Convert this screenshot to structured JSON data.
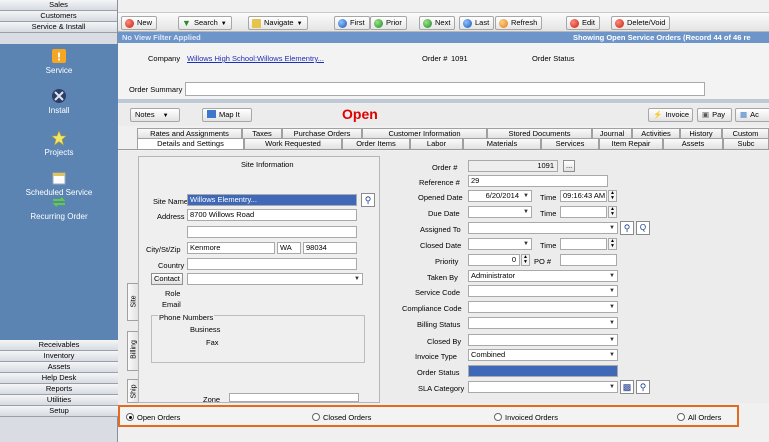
{
  "leftnav": {
    "top_items": [
      "Sales",
      "Customers",
      "Service & Install"
    ],
    "modules": [
      {
        "label": "Service",
        "icon": "warning-icon"
      },
      {
        "label": "Install",
        "icon": "tools-icon"
      },
      {
        "label": "Projects",
        "icon": "star-icon"
      },
      {
        "label": "Scheduled Service",
        "icon": "calendar-icon"
      },
      {
        "label": "Recurring Order",
        "icon": "recycle-icon"
      }
    ],
    "bottom_items": [
      "Receivables",
      "Inventory",
      "Assets",
      "Help Desk",
      "Reports",
      "Utilities",
      "Setup"
    ]
  },
  "toolbar": {
    "new": "New",
    "search": "Search",
    "navigate": "Navigate",
    "first": "First",
    "prior": "Prior",
    "next": "Next",
    "last": "Last",
    "refresh": "Refresh",
    "edit": "Edit",
    "delete_void": "Delete/Void"
  },
  "bluebar": {
    "filter": "No View Filter Applied",
    "status": "Showing Open Service Orders   (Record 44 of 46 re"
  },
  "header": {
    "company_label": "Company",
    "company_value": "Willows High School:Willows Elementry...",
    "order_label": "Order #",
    "order_value": "1091",
    "order_status_label": "Order Status",
    "order_summary_label": "Order Summary",
    "order_summary_value": ""
  },
  "actionbar": {
    "notes": "Notes",
    "map_it": "Map It",
    "status": "Open",
    "invoice": "Invoice",
    "pay": "Pay",
    "ac": "Ac"
  },
  "tabs_row1": [
    "Rates and Assignments",
    "Taxes",
    "Purchase Orders",
    "Customer Information",
    "Stored Documents",
    "Journal",
    "Activities",
    "History",
    "Custom"
  ],
  "tabs_row2": [
    "Details and Settings",
    "Work Requested",
    "Order Items",
    "Labor",
    "Materials",
    "Services",
    "Item Repair",
    "Assets",
    "Subc"
  ],
  "site": {
    "section_title": "Site Information",
    "site_name_label": "Site Name",
    "site_name_value": "Willows Elementry...",
    "address_label": "Address",
    "address_value": "8700 Willows Road",
    "address2_value": "",
    "city_label": "City/St/Zip",
    "city_value": "Kenmore",
    "state_value": "WA",
    "zip_value": "98034",
    "country_label": "Country",
    "country_value": "",
    "contact_label": "Contact",
    "contact_value": "",
    "role_label": "Role",
    "email_label": "Email",
    "phone_numbers_label": "Phone Numbers",
    "business_label": "Business",
    "fax_label": "Fax",
    "zone_label": "Zone",
    "vtabs": [
      "Site",
      "Billing",
      "Ship"
    ]
  },
  "details": {
    "order_label": "Order #",
    "order_value": "1091",
    "reference_label": "Reference #",
    "reference_value": "29",
    "opened_date_label": "Opened Date",
    "opened_date_value": "6/20/2014",
    "time_label": "Time",
    "opened_time_value": "09:16:43 AM",
    "due_date_label": "Due Date",
    "due_date_value": "",
    "due_time_value": "",
    "assigned_to_label": "Assigned To",
    "assigned_to_value": "",
    "closed_date_label": "Closed Date",
    "closed_date_value": "",
    "closed_time_value": "",
    "priority_label": "Priority",
    "priority_value": "0",
    "po_label": "PO #",
    "po_value": "",
    "taken_by_label": "Taken By",
    "taken_by_value": "Administrator",
    "service_code_label": "Service Code",
    "service_code_value": "",
    "compliance_code_label": "Compliance Code",
    "compliance_code_value": "",
    "billing_status_label": "Billing Status",
    "billing_status_value": "",
    "closed_by_label": "Closed By",
    "closed_by_value": "",
    "invoice_type_label": "Invoice Type",
    "invoice_type_value": "Combined",
    "order_status_label": "Order Status",
    "order_status_value": "",
    "sla_category_label": "SLA Category",
    "sla_category_value": ""
  },
  "radiobar": {
    "open_orders": "Open Orders",
    "closed_orders": "Closed Orders",
    "invoiced_orders": "Invoiced Orders",
    "all_orders": "All Orders",
    "selected": "Open Orders"
  },
  "colors": {
    "nav_panel": "#5b84b3",
    "blue_bar": "#6d95c9",
    "status_open": "#e00000",
    "highlight_border": "#e36b1d",
    "selection": "#3f68b8"
  }
}
